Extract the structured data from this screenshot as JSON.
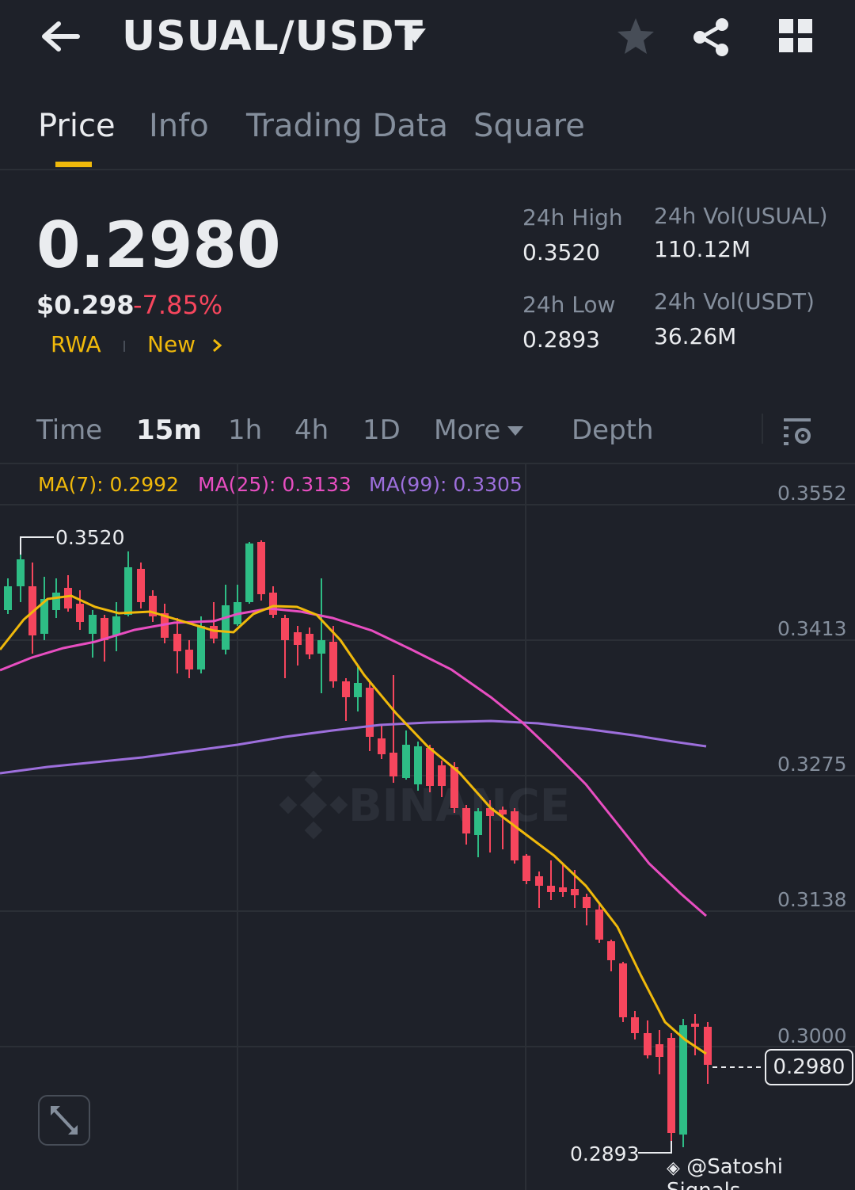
{
  "header": {
    "pair": "USUAL/USDT",
    "icons": [
      "back-arrow-icon",
      "caret-down-icon",
      "star-icon",
      "share-icon",
      "grid-icon"
    ]
  },
  "tabs": [
    {
      "label": "Price",
      "active": true
    },
    {
      "label": "Info",
      "active": false
    },
    {
      "label": "Trading Data",
      "active": false
    },
    {
      "label": "Square",
      "active": false
    }
  ],
  "ticker": {
    "last_price": "0.2980",
    "usd_price": "$0.298",
    "change": "-7.85%",
    "tags": [
      "RWA",
      "New"
    ]
  },
  "stats": {
    "high_label": "24h High",
    "high_value": "0.3520",
    "low_label": "24h Low",
    "low_value": "0.2893",
    "vol_base_label": "24h Vol(USUAL)",
    "vol_base_value": "110.12M",
    "vol_quote_label": "24h Vol(USDT)",
    "vol_quote_value": "36.26M"
  },
  "intervals": {
    "items": [
      "Time",
      "15m",
      "1h",
      "4h",
      "1D",
      "More",
      "Depth"
    ],
    "active": "15m"
  },
  "indicators": {
    "ma7": "MA(7): 0.2992",
    "ma25": "MA(25): 0.3133",
    "ma99": "MA(99): 0.3305"
  },
  "chart": {
    "price_axis": [
      "0.3552",
      "0.3413",
      "0.3275",
      "0.3138",
      "0.3000"
    ],
    "current_price_tag": "0.2980",
    "high_marker": "0.3520",
    "low_marker": "0.2893",
    "watermark": "BINANCE"
  },
  "colors": {
    "background": "#1e2129",
    "up": "#2ebd85",
    "down": "#f6465d",
    "accent": "#f0b90b",
    "ma7": "#f0b90b",
    "ma25": "#e84ec1",
    "ma99": "#9d6fdc"
  },
  "credit": "@Satoshi Signals"
}
